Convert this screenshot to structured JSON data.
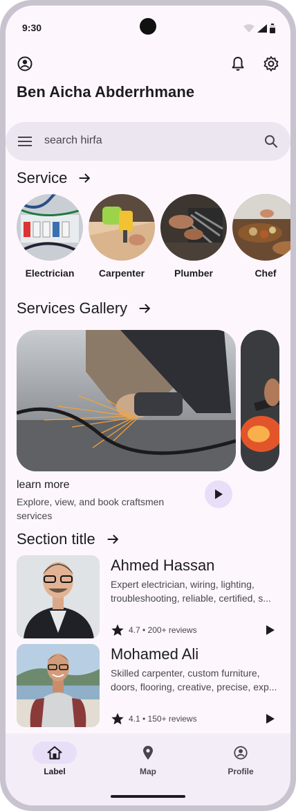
{
  "status_bar": {
    "time": "9:30"
  },
  "header": {
    "username": "Ben Aicha Abderrhmane"
  },
  "search": {
    "placeholder": "search hirfa"
  },
  "services": {
    "title": "Service",
    "items": [
      {
        "label": "Electrician"
      },
      {
        "label": "Carpenter"
      },
      {
        "label": "Plumber"
      },
      {
        "label": "Chef"
      }
    ]
  },
  "gallery": {
    "title": "Services Gallery",
    "card_title": "learn more",
    "card_desc": "Explore, view, and book craftsmen services"
  },
  "section": {
    "title": "Section title",
    "people": [
      {
        "name": "Ahmed Hassan",
        "desc_line1": "Expert electrician, wiring, lighting,",
        "desc_line2": "troubleshooting, reliable, certified, s...",
        "rating": "4.7 • 200+ reviews",
        "rating_value": 4.7
      },
      {
        "name": "Mohamed Ali",
        "desc_line1": "Skilled carpenter, custom furniture,",
        "desc_line2": "doors, flooring, creative, precise, exp...",
        "rating": "4.1 • 150+ reviews",
        "rating_value": 4.1
      }
    ]
  },
  "nav": {
    "items": [
      {
        "label": "Label",
        "icon": "home-icon",
        "active": true
      },
      {
        "label": "Map",
        "icon": "map-pin-icon",
        "active": false
      },
      {
        "label": "Profile",
        "icon": "account-circle-icon",
        "active": false
      }
    ]
  },
  "colors": {
    "surface": "#fdf7fd",
    "search_bg": "#ece6f0",
    "accent_container": "#e8def8",
    "nav_bg": "#f3edf7",
    "text_primary": "#1d1b20",
    "text_secondary": "#49454f"
  }
}
